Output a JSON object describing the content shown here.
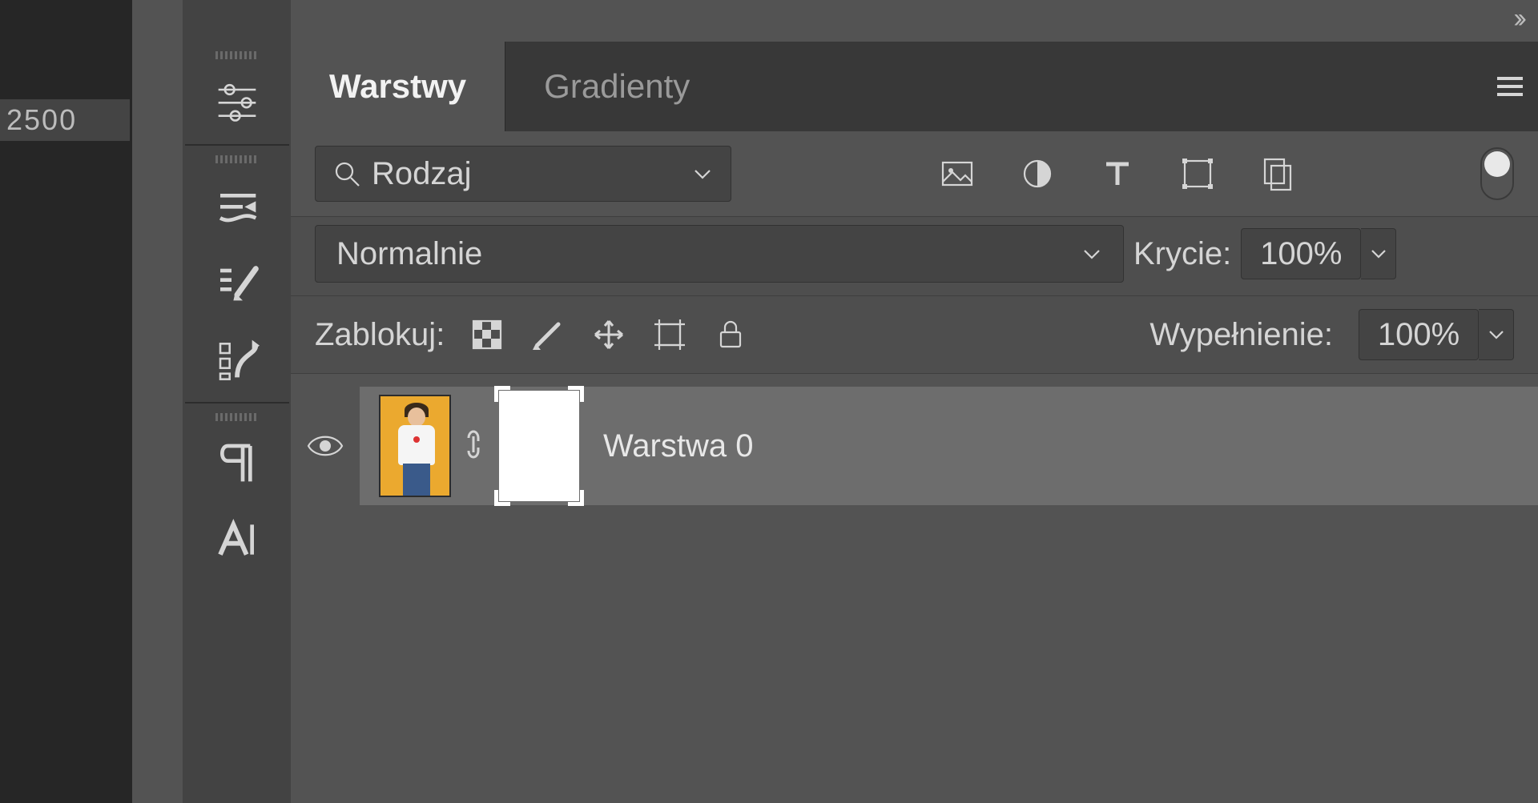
{
  "ruler": {
    "value": "2500"
  },
  "tabs": {
    "layers": "Warstwy",
    "gradients": "Gradienty"
  },
  "filter": {
    "label": "Rodzaj"
  },
  "blend": {
    "mode": "Normalnie"
  },
  "opacity": {
    "label": "Krycie:",
    "value": "100%"
  },
  "fill": {
    "label": "Wypełnienie:",
    "value": "100%"
  },
  "lock": {
    "label": "Zablokuj:"
  },
  "layers": [
    {
      "name": "Warstwa 0"
    }
  ]
}
